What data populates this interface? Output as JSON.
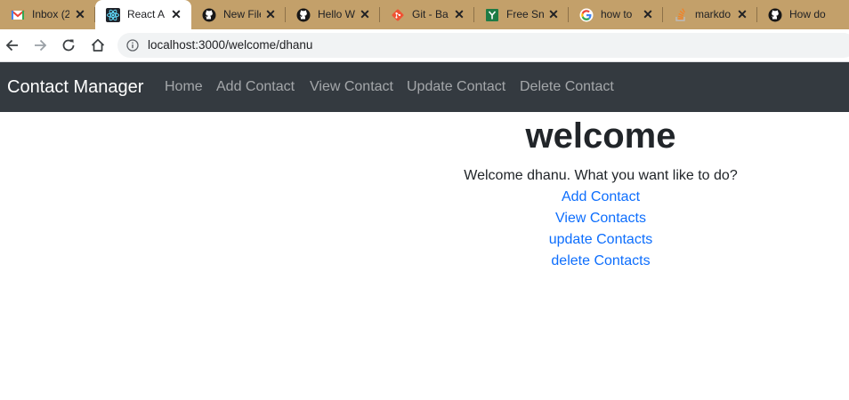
{
  "browser": {
    "tabs": [
      {
        "title": "Inbox (2",
        "icon": "gmail-icon"
      },
      {
        "title": "React A",
        "icon": "react-icon",
        "active": true
      },
      {
        "title": "New File",
        "icon": "github-icon"
      },
      {
        "title": "Hello W",
        "icon": "github-icon"
      },
      {
        "title": "Git - Ba",
        "icon": "git-icon"
      },
      {
        "title": "Free Sni",
        "icon": "bootstrap-snippet-icon"
      },
      {
        "title": "how to",
        "icon": "google-icon"
      },
      {
        "title": "markdo",
        "icon": "stackoverflow-icon"
      },
      {
        "title": "How do",
        "icon": "github-icon"
      }
    ],
    "url": "localhost:3000/welcome/dhanu",
    "colors": {
      "tabstrip": "#c3a06a"
    }
  },
  "navbar": {
    "brand": "Contact Manager",
    "links": [
      "Home",
      "Add Contact",
      "View Contact",
      "Update Contact",
      "Delete Contact"
    ],
    "background": "#343a40"
  },
  "main": {
    "heading": "welcome",
    "greeting": "Welcome dhanu. What you want like to do?",
    "links": [
      "Add Contact",
      "View Contacts",
      "update Contacts",
      "delete Contacts"
    ],
    "link_color": "#0d6efd"
  }
}
